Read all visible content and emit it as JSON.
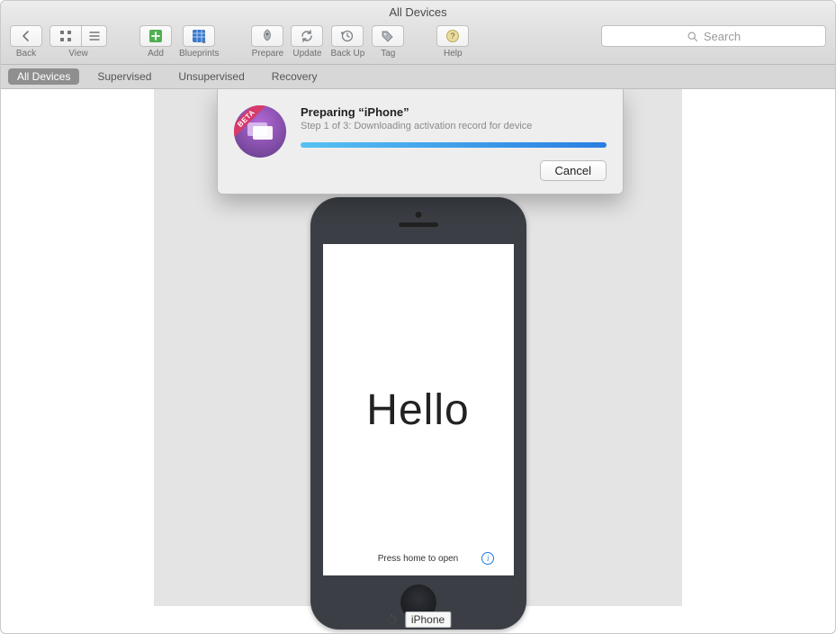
{
  "window": {
    "title": "All Devices"
  },
  "toolbar": {
    "back": "Back",
    "view": "View",
    "add": "Add",
    "blueprints": "Blueprints",
    "prepare": "Prepare",
    "update": "Update",
    "backup": "Back Up",
    "tag": "Tag",
    "help": "Help",
    "search_placeholder": "Search"
  },
  "tabs": {
    "all": "All Devices",
    "supervised": "Supervised",
    "unsupervised": "Unsupervised",
    "recovery": "Recovery"
  },
  "device": {
    "screen_text": "Hello",
    "press_home": "Press home to open",
    "name": "iPhone"
  },
  "dialog": {
    "beta": "BETA",
    "title": "Preparing “iPhone”",
    "subtitle": "Step 1 of 3: Downloading activation record for device",
    "cancel": "Cancel",
    "progress": 100
  }
}
